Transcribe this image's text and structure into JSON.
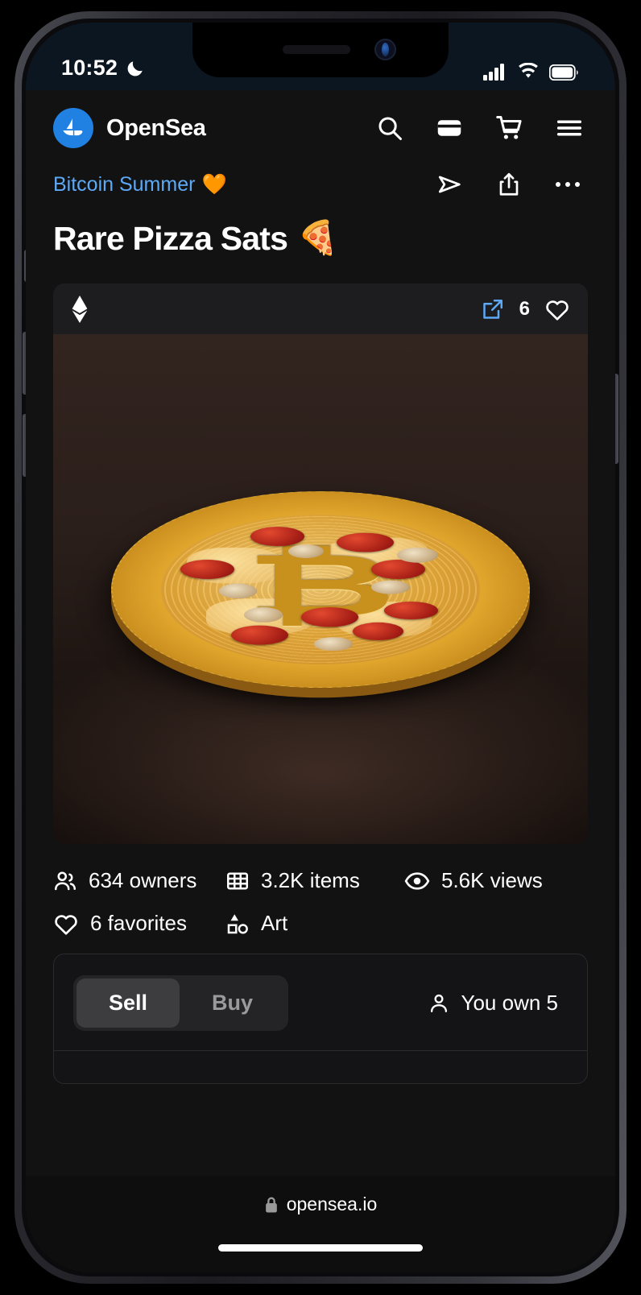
{
  "status_bar": {
    "time": "10:52",
    "dnd_icon": "crescent-moon-icon",
    "signal_icon": "cellular-signal-icon",
    "wifi_icon": "wifi-icon",
    "battery_icon": "battery-full-icon"
  },
  "header": {
    "brand": "OpenSea",
    "logo_icon": "opensea-sailboat-logo",
    "accent_color": "#2081e2",
    "icons": [
      {
        "name": "search-icon",
        "label": "Search"
      },
      {
        "name": "wallet-icon",
        "label": "Wallet"
      },
      {
        "name": "cart-icon",
        "label": "Cart"
      },
      {
        "name": "hamburger-menu-icon",
        "label": "Menu"
      }
    ]
  },
  "breadcrumb": {
    "label": "Bitcoin Summer",
    "emoji": "🧡",
    "link_color": "#5da9f6",
    "actions": [
      {
        "name": "send-icon",
        "label": "Send"
      },
      {
        "name": "share-icon",
        "label": "Share"
      },
      {
        "name": "more-options-icon",
        "label": "More"
      }
    ]
  },
  "page_title": {
    "text": "Rare Pizza Sats",
    "emoji": "🍕"
  },
  "nft_card": {
    "chain_icon": "ethereum-icon",
    "external_link_icon": "external-link-icon",
    "external_link_color": "#5da9f6",
    "favorite_count": "6",
    "favorite_icon": "heart-icon",
    "artwork_alt": "Gold Bitcoin coin styled as a pepperoni and mushroom pizza on a dark brown surface"
  },
  "stats": [
    {
      "icon": "people-icon",
      "value": "634 owners"
    },
    {
      "icon": "grid-icon",
      "value": "3.2K items"
    },
    {
      "icon": "eye-icon",
      "value": "5.6K views"
    },
    {
      "icon": "heart-icon",
      "value": "6 favorites"
    },
    {
      "icon": "shapes-icon",
      "value": "Art"
    }
  ],
  "trade_panel": {
    "tabs": [
      {
        "label": "Sell",
        "active": true
      },
      {
        "label": "Buy",
        "active": false
      }
    ],
    "ownership": {
      "icon": "person-icon",
      "text": "You own 5"
    }
  },
  "browser": {
    "lock_icon": "lock-icon",
    "url": "opensea.io"
  }
}
